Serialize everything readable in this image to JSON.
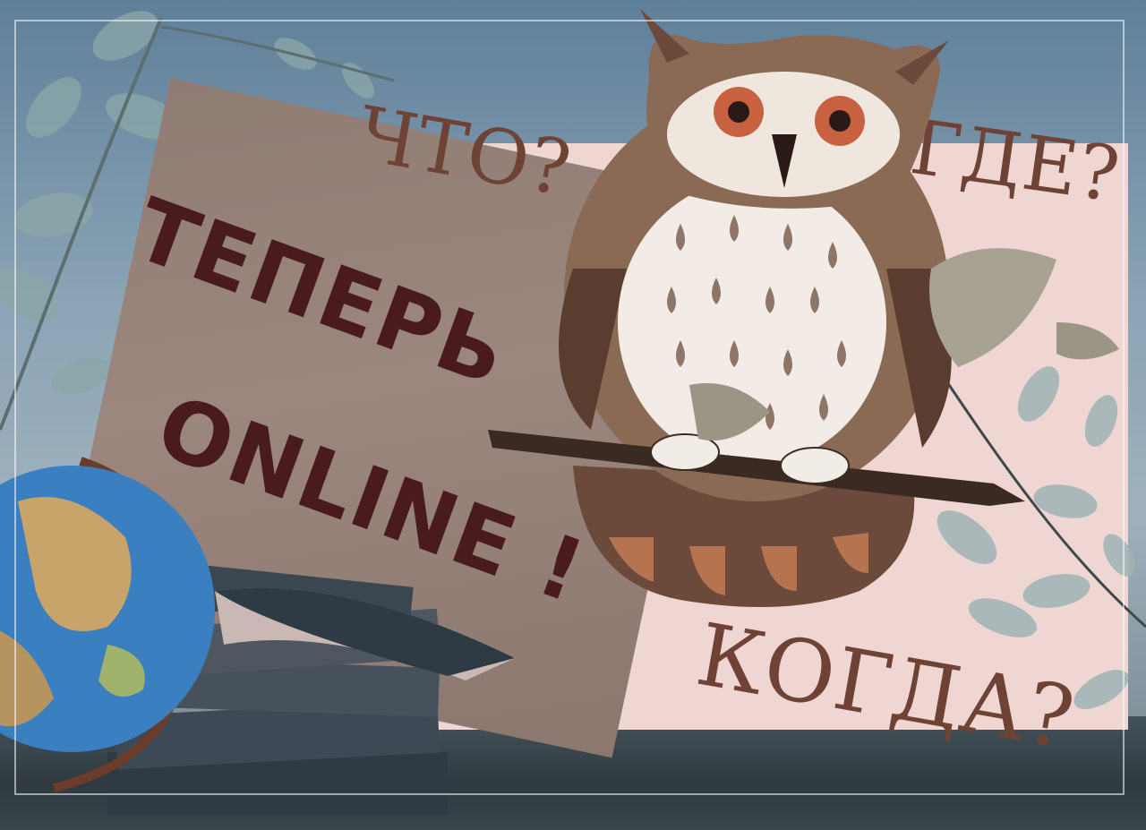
{
  "poster": {
    "questions": [
      "ЧТО?",
      "ГДЕ?",
      "КОГДА?"
    ],
    "slogan_line1": "ТЕПЕРЬ",
    "slogan_line2": "ONLINE !"
  },
  "colors": {
    "question_text": "#6e4335",
    "slogan_text": "#4a1b1d",
    "pink_panel": "#efd6d2",
    "gray_panel": "#938077"
  },
  "illustrations": [
    "owl",
    "globe",
    "book-stack",
    "branch",
    "leaves"
  ]
}
